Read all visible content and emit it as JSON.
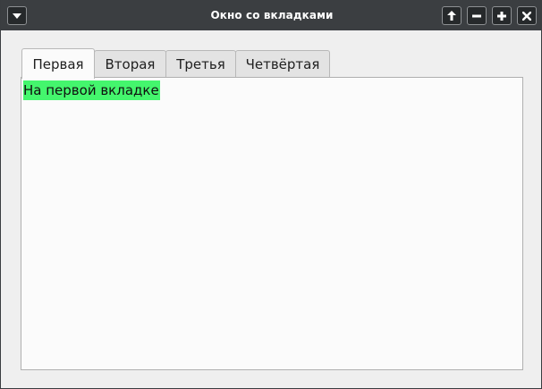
{
  "window": {
    "title": "Окно со вкладками",
    "buttons": {
      "menu": "chevron-down-icon",
      "keep_above": "arrow-up-icon",
      "minimize": "minus-icon",
      "maximize": "plus-icon",
      "close": "close-icon"
    },
    "colors": {
      "titlebar": "#3b3e41",
      "background": "#efefef",
      "highlight": "#44f66d"
    }
  },
  "tabs": [
    {
      "label": "Первая",
      "active": true
    },
    {
      "label": "Вторая",
      "active": false
    },
    {
      "label": "Третья",
      "active": false
    },
    {
      "label": "Четвёртая",
      "active": false
    }
  ],
  "panel": {
    "text": "На первой вкладке"
  }
}
